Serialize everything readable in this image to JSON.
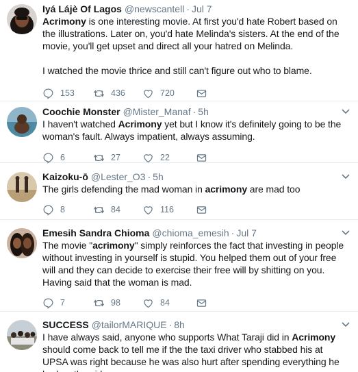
{
  "colors": {
    "text": "#14171a",
    "muted": "#657786",
    "divider": "#e6ecf0"
  },
  "tweets": [
    {
      "name": "Iyá Lájè Of Lagos",
      "handle": "@newscantell",
      "time": "Jul 7",
      "text_parts": [
        {
          "t": "Acrimony",
          "bold": true
        },
        {
          "t": " is one interesting movie. At first you'd hate Robert based on the illustrations. Later on, you'd hate Melinda's sisters. At the end of the movie, you'll get upset and direct all your hatred on Melinda.\n\nI watched the movie thrice and still can't figure out who to blame.",
          "bold": false
        }
      ],
      "replies": "153",
      "retweets": "436",
      "likes": "720"
    },
    {
      "name": "Coochie Monster",
      "handle": "@Mister_Manaf",
      "time": "5h",
      "text_parts": [
        {
          "t": "I haven't watched ",
          "bold": false
        },
        {
          "t": "Acrimony",
          "bold": true
        },
        {
          "t": " yet but I know it's definitely going to be the woman's fault. Always impatient, always assuming.",
          "bold": false
        }
      ],
      "replies": "6",
      "retweets": "27",
      "likes": "22"
    },
    {
      "name": "Kaizoku-ō",
      "handle": "@Lester_O3",
      "time": "5h",
      "text_parts": [
        {
          "t": "The girls defending the mad woman in ",
          "bold": false
        },
        {
          "t": "acrimony",
          "bold": true
        },
        {
          "t": " are mad too",
          "bold": false
        }
      ],
      "replies": "8",
      "retweets": "84",
      "likes": "116"
    },
    {
      "name": "Emesih Sandra Chioma",
      "handle": "@chioma_emesih",
      "time": "Jul 7",
      "text_parts": [
        {
          "t": "The movie \"",
          "bold": false
        },
        {
          "t": "acrimony",
          "bold": true
        },
        {
          "t": "\" simply reinforces the fact that investing in people without investing in yourself is stupid. You helped them out of your free will and they can decide to exercise their free will by shitting on you. Having said that the woman is mad.",
          "bold": false
        }
      ],
      "replies": "7",
      "retweets": "98",
      "likes": "84"
    },
    {
      "name": "SUCCESS",
      "handle": "@tailorMARIQUE",
      "time": "8h",
      "text_parts": [
        {
          "t": "I have always said, anyone who supports What Taraji did in ",
          "bold": false
        },
        {
          "t": "Acrimony",
          "bold": true
        },
        {
          "t": " should come back to tell me if the the taxi driver who stabbed his at UPSA was right because he was also hurt after spending everything he had on the girl",
          "bold": false
        }
      ],
      "replies": "",
      "retweets": "",
      "likes": ""
    }
  ]
}
